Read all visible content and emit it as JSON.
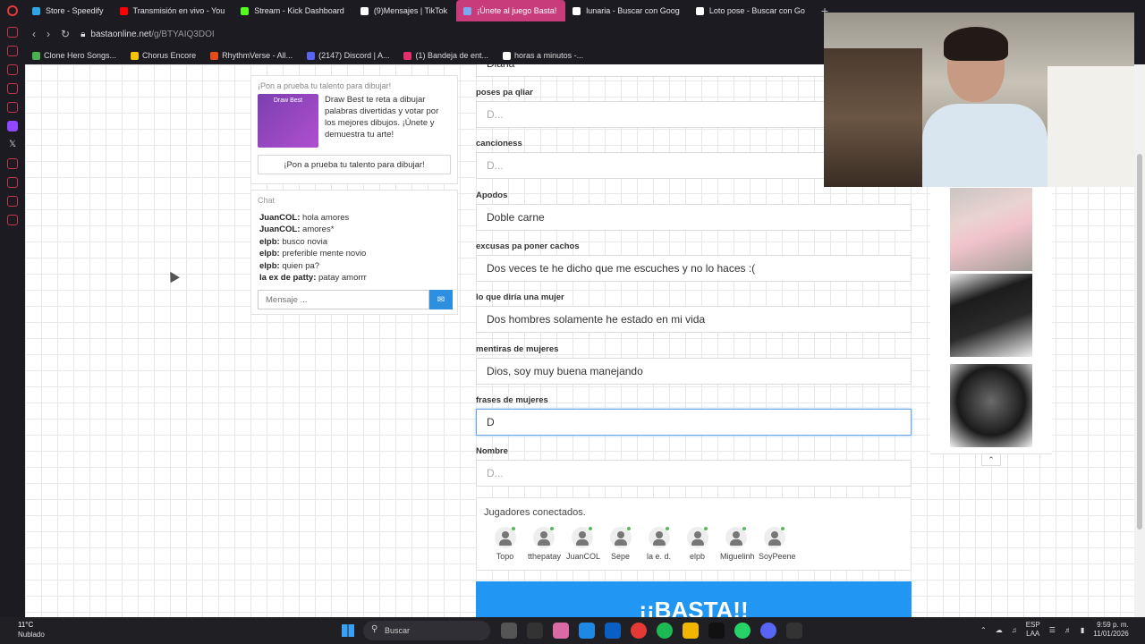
{
  "tabs": [
    {
      "label": "Store - Speedify",
      "color": "#2ea6e6"
    },
    {
      "label": "Transmisión en vivo - You",
      "color": "#ff0000"
    },
    {
      "label": "Stream - Kick Dashboard",
      "color": "#53fc18"
    },
    {
      "label": "(9)Mensajes | TikTok",
      "color": "#ffffff"
    },
    {
      "label": "¡Únete al juego Basta!",
      "color": "#7ea9f0",
      "active": true
    },
    {
      "label": "lunaria - Buscar con Goog",
      "color": "#ffffff"
    },
    {
      "label": "Loto pose - Buscar con Go",
      "color": "#ffffff"
    }
  ],
  "address": {
    "domain": "bastaonline.net",
    "path": "/g/BTYAIQ3DOI"
  },
  "bookmarks": [
    {
      "label": "Clone Hero Songs...",
      "color": "#4caf50"
    },
    {
      "label": "Chorus Encore",
      "color": "#f5c400"
    },
    {
      "label": "RhythmVerse - All...",
      "color": "#e64a19"
    },
    {
      "label": "(2147) Discord | A...",
      "color": "#5865f2"
    },
    {
      "label": "(1) Bandeja de ent...",
      "color": "#e1306c"
    },
    {
      "label": "horas a minutos -...",
      "color": "#ffffff"
    }
  ],
  "promo": {
    "header": "¡Pon a prueba tu talento para dibujar!",
    "thumb_label": "Draw Best",
    "text": "Draw Best te reta a dibujar palabras divertidas y votar por los mejores dibujos. ¡Únete y demuestra tu arte!",
    "cta": "¡Pon a prueba tu talento para dibujar!"
  },
  "chat": {
    "title": "Chat",
    "messages": [
      {
        "user": "JuanCOL:",
        "text": " hola amores"
      },
      {
        "user": "JuanCOL:",
        "text": " amores*"
      },
      {
        "user": "elpb:",
        "text": " busco novia"
      },
      {
        "user": "elpb:",
        "text": " preferible mente novio"
      },
      {
        "user": "elpb:",
        "text": " quien pa?"
      },
      {
        "user": "la ex de patty:",
        "text": " patay amorrr"
      }
    ],
    "placeholder": "Mensaje ..."
  },
  "form": {
    "partial_value": "Diana",
    "fields": [
      {
        "label": "poses pa qliar",
        "value": "",
        "placeholder": "D..."
      },
      {
        "label": "cancioness",
        "value": "",
        "placeholder": "D..."
      },
      {
        "label": "Apodos",
        "value": "Doble carne",
        "placeholder": ""
      },
      {
        "label": "excusas pa poner cachos",
        "value": "Dos veces te he dicho que me escuches y no lo haces :(",
        "placeholder": ""
      },
      {
        "label": "lo que diría una mujer",
        "value": "Dos hombres solamente he estado en mi vida",
        "placeholder": ""
      },
      {
        "label": "mentiras de mujeres",
        "value": "Dios, soy muy buena manejando",
        "placeholder": ""
      },
      {
        "label": "frases de mujeres",
        "value": "D",
        "placeholder": "",
        "focused": true
      },
      {
        "label": "Nombre",
        "value": "",
        "placeholder": "D..."
      }
    ]
  },
  "players": {
    "title": "Jugadores conectados.",
    "list": [
      "Topo",
      "tthepatay",
      "JuanCOL",
      "Sepe",
      "la e. d.",
      "elpb",
      "Miguelinh",
      "SoyPeene"
    ]
  },
  "basta_button": "¡¡BASTA!!",
  "taskbar": {
    "weather_temp": "11°C",
    "weather_desc": "Nublado",
    "search": "Buscar",
    "lang_1": "ESP",
    "lang_2": "LAA",
    "time": "9:59 p. m.",
    "date": "11/01/2026"
  }
}
